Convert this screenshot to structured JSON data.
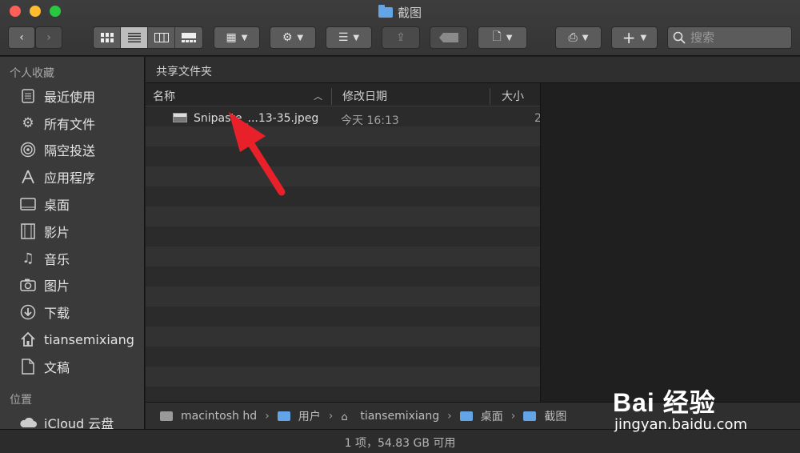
{
  "window": {
    "title": "截图"
  },
  "toolbar": {
    "search_placeholder": "搜索",
    "view_modes": [
      "icon",
      "list",
      "column",
      "gallery"
    ],
    "active_view": "list"
  },
  "sidebar": {
    "favorites_label": "个人收藏",
    "favorites": [
      {
        "label": "最近使用",
        "icon": "recent-icon"
      },
      {
        "label": "所有文件",
        "icon": "gear-icon"
      },
      {
        "label": "隔空投送",
        "icon": "airdrop-icon"
      },
      {
        "label": "应用程序",
        "icon": "applications-icon"
      },
      {
        "label": "桌面",
        "icon": "desktop-icon"
      },
      {
        "label": "影片",
        "icon": "film-icon"
      },
      {
        "label": "音乐",
        "icon": "music-icon"
      },
      {
        "label": "图片",
        "icon": "camera-icon"
      },
      {
        "label": "下载",
        "icon": "download-icon"
      },
      {
        "label": "tiansemixiang",
        "icon": "home-icon"
      },
      {
        "label": "文稿",
        "icon": "document-icon"
      }
    ],
    "locations_label": "位置",
    "locations": [
      {
        "label": "iCloud 云盘",
        "icon": "cloud-icon"
      }
    ]
  },
  "content": {
    "header": "共享文件夹",
    "columns": {
      "name": "名称",
      "modified": "修改日期",
      "size": "大小"
    },
    "files": [
      {
        "name": "Snipaste_...13-35.jpeg",
        "modified": "今天 16:13",
        "size": "2"
      }
    ]
  },
  "pathbar": [
    "macintosh hd",
    "用户",
    "tiansemixiang",
    "桌面",
    "截图"
  ],
  "status": "1 项，54.83 GB 可用",
  "watermark": {
    "logo": "Bai 经验",
    "url": "jingyan.baidu.com"
  },
  "colors": {
    "accent_folder": "#62a4e6",
    "annotation_arrow": "#e8202a"
  }
}
